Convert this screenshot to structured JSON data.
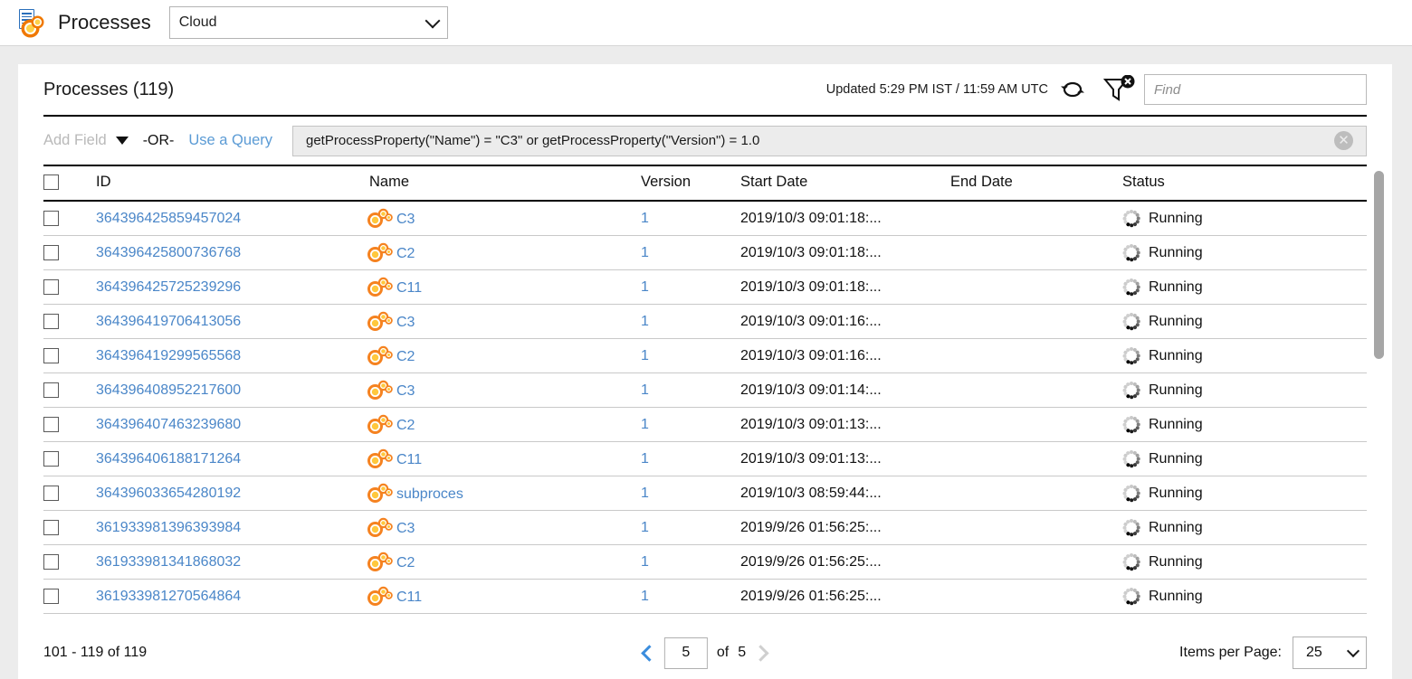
{
  "app": {
    "icon": "process-document-gears-icon",
    "title": "Processes",
    "scope_select": {
      "value": "Cloud",
      "chevron": "chevron-down-icon"
    }
  },
  "card": {
    "title": "Processes (119)",
    "updated_text": "Updated 5:29 PM IST / 11:59 AM UTC",
    "refresh_icon": "refresh-icon",
    "filter_icon": "filter-clear-icon",
    "find": {
      "placeholder": "Find",
      "value": ""
    }
  },
  "filter": {
    "add_field_label": "Add Field",
    "caret_icon": "caret-down-icon",
    "operator_label": "-OR-",
    "use_query_label": "Use a Query",
    "query_text": "getProcessProperty(\"Name\") = \"C3\" or  getProcessProperty(\"Version\") = 1.0",
    "clear_icon": "clear-query-icon",
    "clear_glyph": "✕"
  },
  "table": {
    "columns": [
      "",
      "ID",
      "Name",
      "Version",
      "Start Date",
      "End Date",
      "Status"
    ],
    "rows": [
      {
        "id": "364396425859457024",
        "name": "C3",
        "version": "1",
        "start": "2019/10/3 09:01:18:...",
        "end": "",
        "status": "Running"
      },
      {
        "id": "364396425800736768",
        "name": "C2",
        "version": "1",
        "start": "2019/10/3 09:01:18:...",
        "end": "",
        "status": "Running"
      },
      {
        "id": "364396425725239296",
        "name": "C11",
        "version": "1",
        "start": "2019/10/3 09:01:18:...",
        "end": "",
        "status": "Running"
      },
      {
        "id": "364396419706413056",
        "name": "C3",
        "version": "1",
        "start": "2019/10/3 09:01:16:...",
        "end": "",
        "status": "Running"
      },
      {
        "id": "364396419299565568",
        "name": "C2",
        "version": "1",
        "start": "2019/10/3 09:01:16:...",
        "end": "",
        "status": "Running"
      },
      {
        "id": "364396408952217600",
        "name": "C3",
        "version": "1",
        "start": "2019/10/3 09:01:14:...",
        "end": "",
        "status": "Running"
      },
      {
        "id": "364396407463239680",
        "name": "C2",
        "version": "1",
        "start": "2019/10/3 09:01:13:...",
        "end": "",
        "status": "Running"
      },
      {
        "id": "364396406188171264",
        "name": "C11",
        "version": "1",
        "start": "2019/10/3 09:01:13:...",
        "end": "",
        "status": "Running"
      },
      {
        "id": "364396033654280192",
        "name": "subproces",
        "version": "1",
        "start": "2019/10/3 08:59:44:...",
        "end": "",
        "status": "Running"
      },
      {
        "id": "361933981396393984",
        "name": "C3",
        "version": "1",
        "start": "2019/9/26 01:56:25:...",
        "end": "",
        "status": "Running"
      },
      {
        "id": "361933981341868032",
        "name": "C2",
        "version": "1",
        "start": "2019/9/26 01:56:25:...",
        "end": "",
        "status": "Running"
      },
      {
        "id": "361933981270564864",
        "name": "C11",
        "version": "1",
        "start": "2019/9/26 01:56:25:...",
        "end": "",
        "status": "Running"
      }
    ]
  },
  "footer": {
    "range_text": "101 - 119   of   119",
    "prev_icon": "chevron-left-icon",
    "next_icon": "chevron-right-icon",
    "page_value": "5",
    "of_label": "of",
    "total_pages": "5",
    "items_per_page_label": "Items per Page:",
    "items_per_page_value": "25",
    "items_per_page_chevron": "chevron-down-icon"
  },
  "colors": {
    "link": "#4a86c8",
    "accent_orange": "#f58220",
    "page_bg": "#ececec",
    "query_bg": "#ececec",
    "muted": "#b9b9b9"
  }
}
